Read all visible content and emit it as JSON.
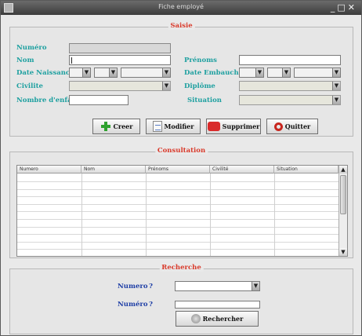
{
  "window": {
    "title": "Fiche employé",
    "controls": [
      "_",
      "□",
      "✕"
    ]
  },
  "saisie": {
    "legend": "Saisie",
    "labels": {
      "numero": "Numéro",
      "nom": "Nom",
      "prenoms": "Prénoms",
      "date_naissance": "Date Naissance",
      "date_embauche": "Date Embauche",
      "civilite": "Civilite",
      "diplome": "Diplôme",
      "nombre_enfant": "Nombre d'enfant",
      "situation": "Situation"
    },
    "values": {
      "numero": "",
      "nom": "",
      "prenoms": "",
      "nombre_enfant": ""
    },
    "buttons": {
      "creer": "Creer",
      "modifier": "Modifier",
      "supprimer": "Supprimer",
      "quitter": "Quitter"
    }
  },
  "consultation": {
    "legend": "Consultation",
    "columns": [
      "Numero",
      "Nom",
      "Prénoms",
      "Civilité",
      "Situation"
    ],
    "rows": []
  },
  "recherche": {
    "legend": "Recherche",
    "labels": {
      "numero_combo": "Numero",
      "numero_field": "Numéro"
    },
    "question_mark": "?",
    "button": "Rechercher"
  },
  "colors": {
    "label_teal": "#1ea0a0",
    "legend_red": "#d93a2b",
    "label_blue": "#1f3fa6"
  }
}
